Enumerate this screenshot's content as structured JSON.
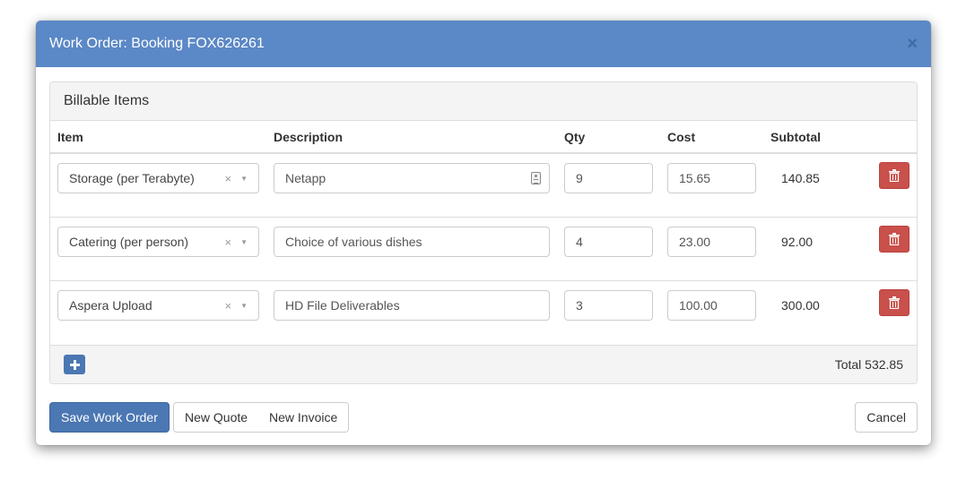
{
  "modal": {
    "title": "Work Order: Booking FOX626261",
    "close_label": "×"
  },
  "panel": {
    "heading": "Billable Items",
    "columns": [
      "Item",
      "Description",
      "Qty",
      "Cost",
      "Subtotal"
    ],
    "rows": [
      {
        "item": "Storage (per Terabyte)",
        "description": "Netapp",
        "qty": "9",
        "cost": "15.65",
        "subtotal": "140.85"
      },
      {
        "item": "Catering (per person)",
        "description": "Choice of various dishes",
        "qty": "4",
        "cost": "23.00",
        "subtotal": "92.00"
      },
      {
        "item": "Aspera Upload",
        "description": "HD File Deliverables",
        "qty": "3",
        "cost": "100.00",
        "subtotal": "300.00"
      }
    ],
    "select_clear": "×",
    "select_arrow": "▼",
    "total_label": "Total 532.85"
  },
  "buttons": {
    "save": "Save Work Order",
    "new_quote": "New Quote",
    "new_invoice": "New Invoice",
    "cancel": "Cancel"
  },
  "colors": {
    "header": "#5b88c6",
    "primary": "#4b77b3",
    "danger": "#c9504b"
  }
}
